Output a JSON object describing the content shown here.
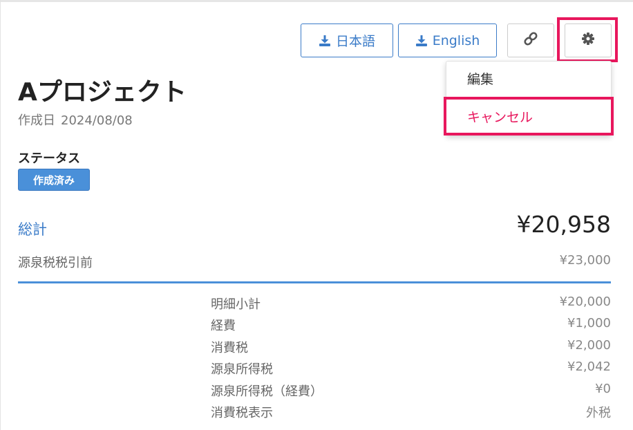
{
  "toolbar": {
    "download_jp_label": "日本語",
    "download_en_label": "English",
    "link_icon": "link-icon",
    "settings_icon": "gear-icon",
    "download_icon": "download-icon"
  },
  "menu": {
    "edit_label": "編集",
    "cancel_label": "キャンセル"
  },
  "project": {
    "title": "Aプロジェクト",
    "created_label": "作成日",
    "created_date": "2024/08/08",
    "status_label": "ステータス",
    "status_badge": "作成済み"
  },
  "summary": {
    "total_label": "総計",
    "total_value": "¥20,958",
    "pretax_label": "源泉税税引前",
    "pretax_value": "¥23,000"
  },
  "breakdown": [
    {
      "label": "明細小計",
      "value": "¥20,000"
    },
    {
      "label": "経費",
      "value": "¥1,000"
    },
    {
      "label": "消費税",
      "value": "¥2,000"
    },
    {
      "label": "源泉所得税",
      "value": "¥2,042"
    },
    {
      "label": "源泉所得税（経費）",
      "value": "¥0"
    },
    {
      "label": "消費税表示",
      "value": "外税"
    }
  ],
  "colors": {
    "accent": "#3a7bc8",
    "highlight": "#e8175d",
    "badge": "#4a90d9"
  }
}
